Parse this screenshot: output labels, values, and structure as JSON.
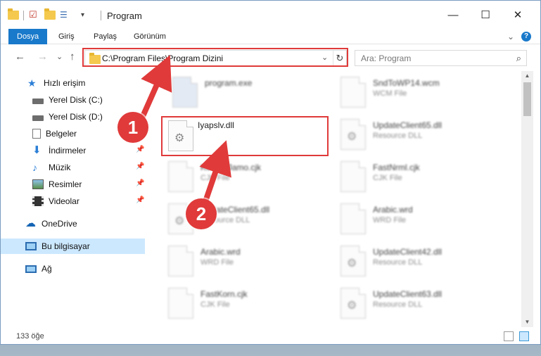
{
  "window": {
    "title": "Program",
    "controls": {
      "minimize": "—",
      "maximize": "☐",
      "close": "✕"
    }
  },
  "ribbon": {
    "tabs": [
      "Dosya",
      "Giriş",
      "Paylaş",
      "Görünüm"
    ],
    "expand": "⌄",
    "help": "?"
  },
  "navbar": {
    "back": "←",
    "forward": "→",
    "recent": "⌄",
    "up": "↑",
    "address": "C:\\Program Files\\Program Dizini",
    "address_dropdown": "⌄",
    "refresh": "↻",
    "search_placeholder": "Ara: Program",
    "search_icon": "⌕"
  },
  "sidebar": {
    "items": [
      {
        "label": "Hızlı erişim",
        "icon": "star-icon",
        "pinned": false
      },
      {
        "label": "Yerel Disk (C:)",
        "icon": "drive-icon",
        "pinned": false
      },
      {
        "label": "Yerel Disk (D:)",
        "icon": "drive-icon",
        "pinned": false
      },
      {
        "label": "Belgeler",
        "icon": "documents-icon",
        "pinned": false
      },
      {
        "label": "İndirmeler",
        "icon": "download-icon",
        "pinned": true
      },
      {
        "label": "Müzik",
        "icon": "music-icon",
        "pinned": true
      },
      {
        "label": "Resimler",
        "icon": "pictures-icon",
        "pinned": true
      },
      {
        "label": "Videolar",
        "icon": "video-icon",
        "pinned": true
      },
      {
        "label": "OneDrive",
        "icon": "cloud-icon",
        "pinned": false
      },
      {
        "label": "Bu bilgisayar",
        "icon": "computer-icon",
        "pinned": false,
        "selected": true
      },
      {
        "label": "Ağ",
        "icon": "network-icon",
        "pinned": false
      }
    ],
    "pin_glyph": "📌"
  },
  "files": {
    "left": [
      {
        "name": "program.exe",
        "type": ""
      },
      {
        "name": "Iyapslv.dll",
        "type": ""
      },
      {
        "name": "KoreanJamo.cjk",
        "type": "CJK File"
      },
      {
        "name": "UpdateClient65.dll",
        "type": "Resource DLL"
      },
      {
        "name": "Arabic.wrd",
        "type": "WRD File"
      },
      {
        "name": "FastKorn.cjk",
        "type": "CJK File"
      }
    ],
    "right": [
      {
        "name": "SndToWP14.wcm",
        "type": "WCM File"
      },
      {
        "name": "UpdateClient65.dll",
        "type": "Resource DLL"
      },
      {
        "name": "FastNrml.cjk",
        "type": "CJK File"
      },
      {
        "name": "Arabic.wrd",
        "type": "WRD File"
      },
      {
        "name": "UpdateClient42.dll",
        "type": "Resource DLL"
      },
      {
        "name": "UpdateClient63.dll",
        "type": "Resource DLL"
      }
    ]
  },
  "status": {
    "count": "133 öğe"
  },
  "annotations": {
    "badge1": "1",
    "badge2": "2"
  },
  "colors": {
    "accent": "#1979ca",
    "highlight": "#e03a3a",
    "selected": "#cce8ff"
  }
}
